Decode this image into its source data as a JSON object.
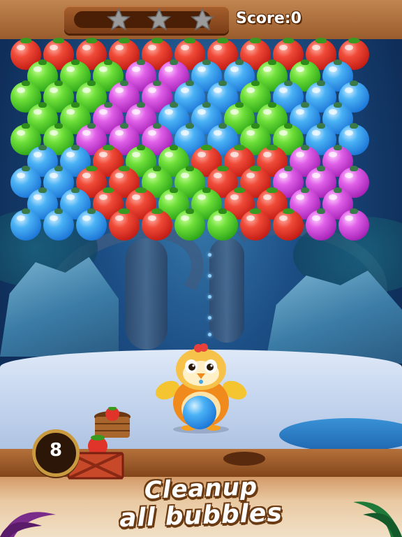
{
  "hud": {
    "score_label": "Score:0",
    "stars_total": 3,
    "stars_earned": 0,
    "shots_remaining": "8"
  },
  "board": {
    "colors": {
      "red": "#e0342a",
      "green": "#4cc92a",
      "blue": "#2b8fe6",
      "purple": "#c23ad1"
    },
    "rows": [
      [
        "red",
        "red",
        "red",
        "red",
        "red",
        "red",
        "red",
        "red",
        "red",
        "red",
        "red"
      ],
      [
        "green",
        "green",
        "green",
        "purple",
        "purple",
        "blue",
        "blue",
        "green",
        "green",
        "blue"
      ],
      [
        "green",
        "green",
        "green",
        "purple",
        "purple",
        "blue",
        "blue",
        "green",
        "blue",
        "blue",
        "blue"
      ],
      [
        "green",
        "green",
        "purple",
        "purple",
        "blue",
        "blue",
        "green",
        "green",
        "blue",
        "blue"
      ],
      [
        "green",
        "green",
        "purple",
        "purple",
        "purple",
        "blue",
        "blue",
        "green",
        "green",
        "blue",
        "blue"
      ],
      [
        "blue",
        "blue",
        "red",
        "green",
        "green",
        "red",
        "red",
        "red",
        "purple",
        "purple"
      ],
      [
        "blue",
        "blue",
        "red",
        "red",
        "green",
        "green",
        "red",
        "red",
        "purple",
        "purple",
        "purple"
      ],
      [
        "blue",
        "blue",
        "red",
        "red",
        "green",
        "green",
        "red",
        "red",
        "purple",
        "purple"
      ],
      [
        "blue",
        "blue",
        "blue",
        "red",
        "red",
        "green",
        "green",
        "red",
        "red",
        "purple",
        "purple"
      ]
    ]
  },
  "shooter": {
    "character": "chicken",
    "loaded_bubble_color": "blue"
  },
  "tagline": {
    "line1": "Cleanup",
    "line2": "all bubbles"
  },
  "icons": {
    "star": "star-icon",
    "basket": "fruit-basket-icon",
    "crate": "fruit-crate-icon",
    "shots": "shots-counter-icon"
  }
}
